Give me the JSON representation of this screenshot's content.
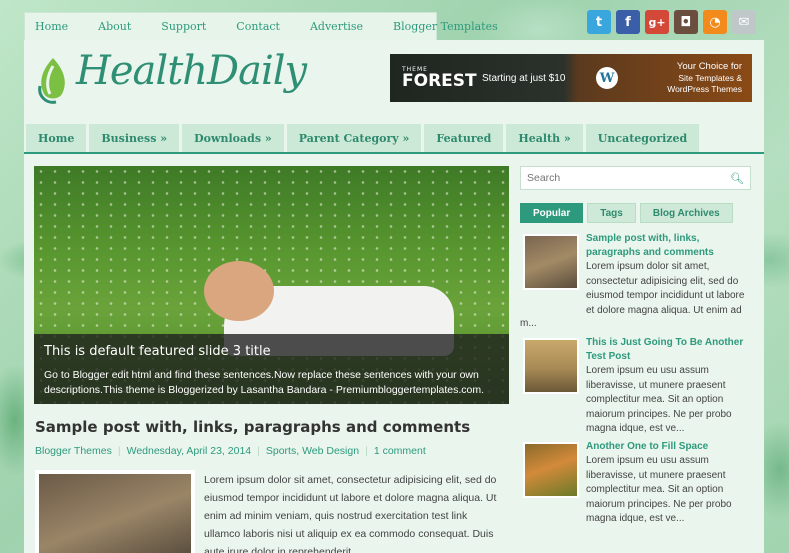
{
  "top_nav": [
    "Home",
    "About",
    "Support",
    "Contact",
    "Advertise",
    "Blogger Templates"
  ],
  "social_icons": [
    {
      "name": "twitter-icon",
      "glyph": "t",
      "color": "#3aa6de"
    },
    {
      "name": "facebook-icon",
      "glyph": "f",
      "color": "#3b5ea8"
    },
    {
      "name": "google-plus-icon",
      "glyph": "g+",
      "color": "#d34836"
    },
    {
      "name": "instagram-icon",
      "glyph": "◘",
      "color": "#6b4e3d"
    },
    {
      "name": "rss-icon",
      "glyph": "◔",
      "color": "#f28a1c"
    },
    {
      "name": "email-icon",
      "glyph": "✉",
      "color": "#bfc7c9"
    }
  ],
  "site": {
    "title": "HealthDaily"
  },
  "ad": {
    "brand_small": "THEME",
    "brand": "FOREST",
    "price": "Starting at just $10",
    "wp_glyph": "W",
    "choice_title": "Your Choice for",
    "choice_line1": "Site Templates &",
    "choice_line2": "WordPress Themes"
  },
  "main_nav": [
    "Home",
    "Business »",
    "Downloads »",
    "Parent Category »",
    "Featured",
    "Health »",
    "Uncategorized"
  ],
  "slider": {
    "title": "This is default featured slide 3 title",
    "text": "Go to Blogger edit html and find these sentences.Now replace these sentences with your own descriptions.This theme is Bloggerized by Lasantha Bandara - Premiumbloggertemplates.com."
  },
  "post": {
    "title": "Sample post with, links, paragraphs and comments",
    "author": "Blogger Themes",
    "date": "Wednesday, April 23, 2014",
    "label1": "Sports",
    "label2": "Web Design",
    "comments": "1 comment",
    "excerpt": "Lorem ipsum dolor sit amet, consectetur adipisicing elit, sed do eiusmod tempor incididunt ut labore et dolore magna aliqua. Ut enim ad minim veniam, quis nostrud exercitation test link ullamco laboris nisi ut aliquip ex ea commodo consequat. Duis aute irure dolor in reprehenderit..."
  },
  "search": {
    "placeholder": "Search"
  },
  "tabs": [
    "Popular",
    "Tags",
    "Blog Archives"
  ],
  "side_posts": [
    {
      "title": "Sample post with, links, paragraphs and comments",
      "body": "Lorem ipsum dolor sit amet, consectetur adipisicing elit, sed do eiusmod tempor incididunt ut labore et dolore magna aliqua. Ut enim ad",
      "more": "m..."
    },
    {
      "title": "This is Just Going To Be Another Test Post",
      "body": "Lorem ipsum eu usu assum liberavisse, ut munere praesent complectitur mea. Sit an option maiorum principes. Ne per probo magna idque, est ve..."
    },
    {
      "title": "Another One to Fill Space",
      "body": "Lorem ipsum eu usu assum liberavisse, ut munere praesent complectitur mea. Sit an option maiorum principes. Ne per probo magna idque, est ve..."
    }
  ]
}
